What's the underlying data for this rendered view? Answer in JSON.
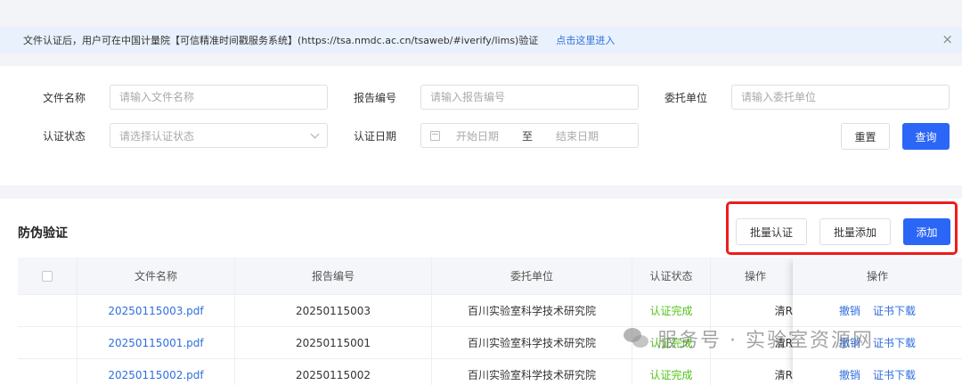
{
  "notice": {
    "text": "文件认证后，用户可在中国计量院【可信精准时间戳服务系统】(https://tsa.nmdc.ac.cn/tsaweb/#iverify/lims)验证",
    "link_label": "点击这里进入",
    "close_icon": "×"
  },
  "filters": {
    "file_name": {
      "label": "文件名称",
      "placeholder": "请输入文件名称"
    },
    "report_no": {
      "label": "报告编号",
      "placeholder": "请输入报告编号"
    },
    "client": {
      "label": "委托单位",
      "placeholder": "请输入委托单位"
    },
    "status": {
      "label": "认证状态",
      "placeholder": "请选择认证状态"
    },
    "date": {
      "label": "认证日期",
      "start_placeholder": "开始日期",
      "separator": "至",
      "end_placeholder": "结束日期"
    },
    "reset_label": "重置",
    "search_label": "查询"
  },
  "list": {
    "title": "防伪验证",
    "batch_verify_label": "批量认证",
    "batch_add_label": "批量添加",
    "add_label": "添加"
  },
  "table": {
    "columns": [
      "文件名称",
      "报告编号",
      "委托单位",
      "认证状态",
      "操作",
      "操作"
    ],
    "rows": [
      {
        "file": "20250115003.pdf",
        "report": "20250115003",
        "client": "百川实验室科学技术研究院",
        "status": "认证完成",
        "op_partial": "清R",
        "op_revoke": "撤销",
        "op_download": "证书下载"
      },
      {
        "file": "20250115001.pdf",
        "report": "20250115001",
        "client": "百川实验室科学技术研究院",
        "status": "认证完成",
        "op_partial": "清R",
        "op_revoke": "撤销",
        "op_download": "证书下载"
      },
      {
        "file": "20250115002.pdf",
        "report": "20250115002",
        "client": "百川实验室科学技术研究院",
        "status": "认证完成",
        "op_partial": "清R",
        "op_revoke": "撤销",
        "op_download": "证书下载"
      }
    ]
  },
  "watermark": {
    "text": "服务号 · 实验室资源网"
  }
}
